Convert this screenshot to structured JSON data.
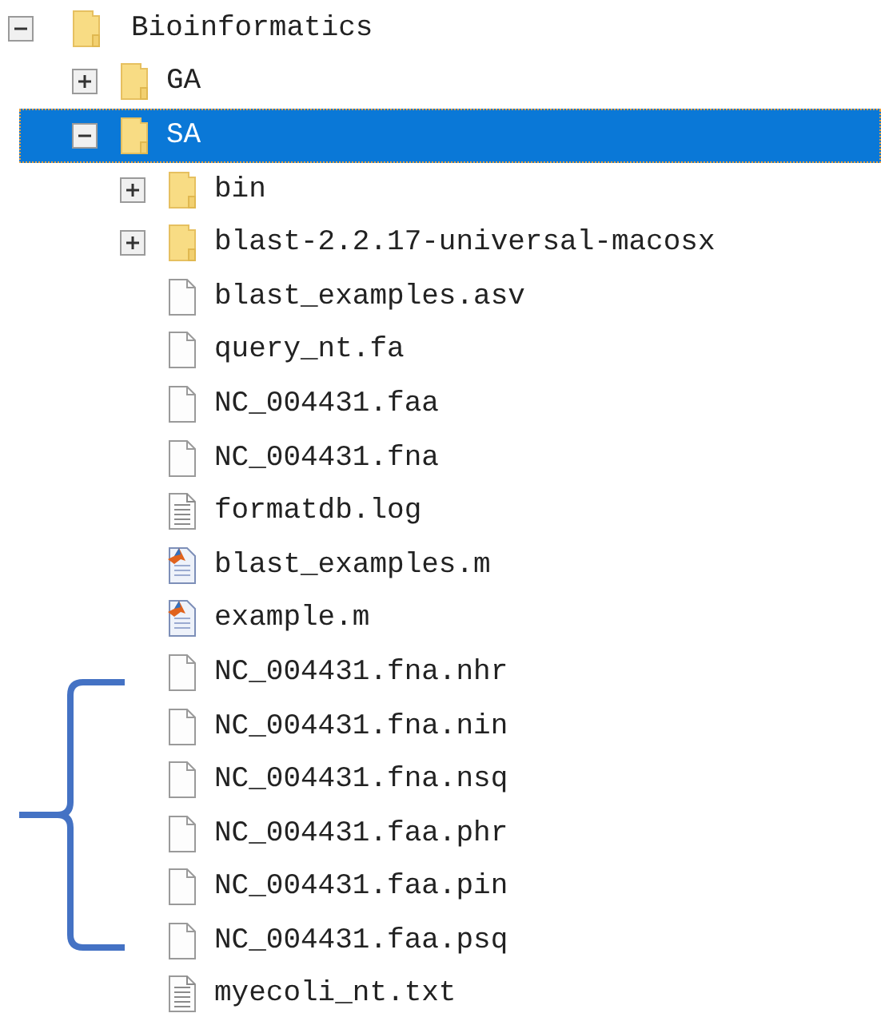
{
  "tree": [
    {
      "label": "Bioinformatics",
      "kind": "folder",
      "expanded": true,
      "selected": false,
      "children": [
        {
          "label": "GA",
          "kind": "folder",
          "expanded": false,
          "selected": false
        },
        {
          "label": "SA",
          "kind": "folder",
          "expanded": true,
          "selected": true,
          "children": [
            {
              "label": "bin",
              "kind": "folder",
              "expanded": false,
              "selected": false
            },
            {
              "label": "blast-2.2.17-universal-macosx",
              "kind": "folder",
              "expanded": false,
              "selected": false
            },
            {
              "label": "blast_examples.asv",
              "kind": "file",
              "selected": false
            },
            {
              "label": "query_nt.fa",
              "kind": "file",
              "selected": false
            },
            {
              "label": "NC_004431.faa",
              "kind": "file",
              "selected": false
            },
            {
              "label": "NC_004431.fna",
              "kind": "file",
              "selected": false
            },
            {
              "label": "formatdb.log",
              "kind": "text",
              "selected": false
            },
            {
              "label": "blast_examples.m",
              "kind": "matlab",
              "selected": false
            },
            {
              "label": "example.m",
              "kind": "matlab",
              "selected": false
            },
            {
              "label": "NC_004431.fna.nhr",
              "kind": "file",
              "selected": false
            },
            {
              "label": "NC_004431.fna.nin",
              "kind": "file",
              "selected": false
            },
            {
              "label": "NC_004431.fna.nsq",
              "kind": "file",
              "selected": false
            },
            {
              "label": "NC_004431.faa.phr",
              "kind": "file",
              "selected": false
            },
            {
              "label": "NC_004431.faa.pin",
              "kind": "file",
              "selected": false
            },
            {
              "label": "NC_004431.faa.psq",
              "kind": "file",
              "selected": false
            },
            {
              "label": "myecoli_nt.txt",
              "kind": "text",
              "selected": false
            }
          ]
        }
      ]
    }
  ]
}
